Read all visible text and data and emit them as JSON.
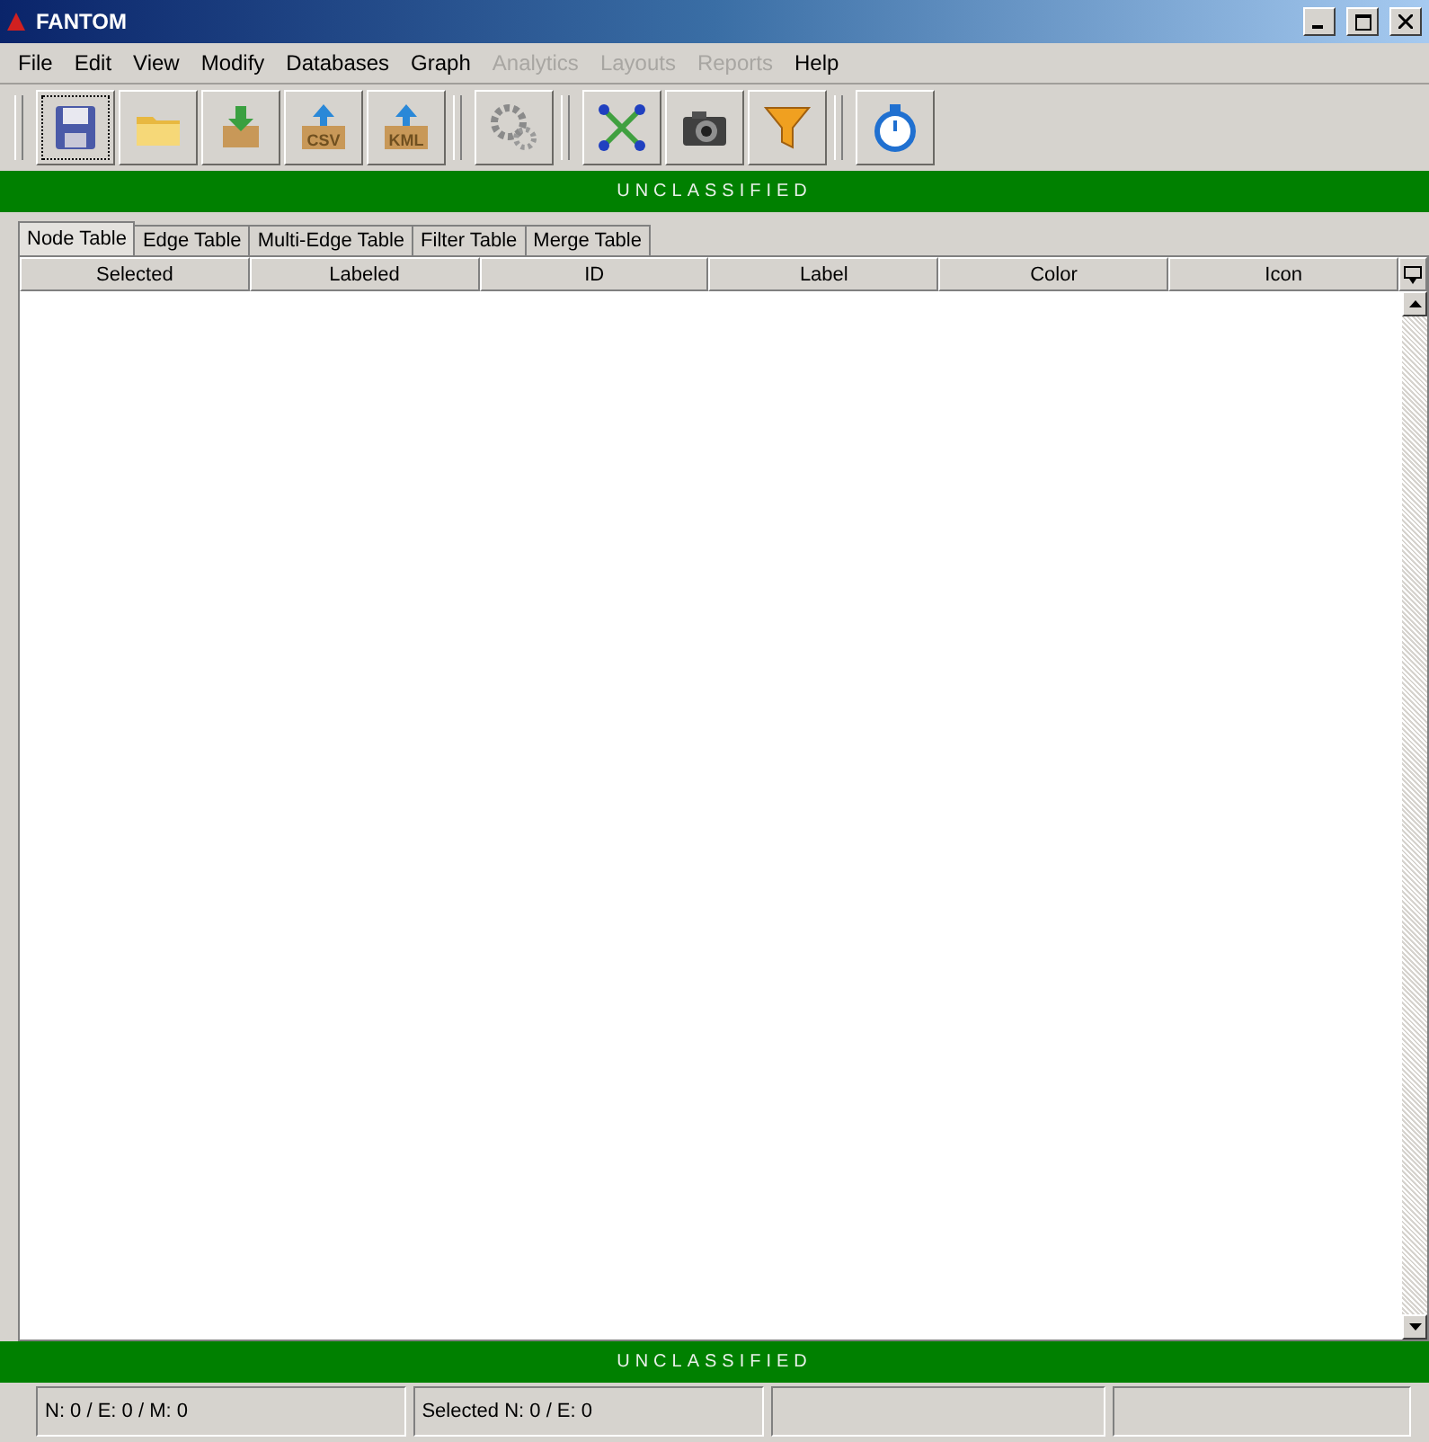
{
  "window": {
    "title": "FANTOM"
  },
  "menu": [
    {
      "label": "File",
      "disabled": false
    },
    {
      "label": "Edit",
      "disabled": false
    },
    {
      "label": "View",
      "disabled": false
    },
    {
      "label": "Modify",
      "disabled": false
    },
    {
      "label": "Databases",
      "disabled": false
    },
    {
      "label": "Graph",
      "disabled": false
    },
    {
      "label": "Analytics",
      "disabled": true
    },
    {
      "label": "Layouts",
      "disabled": true
    },
    {
      "label": "Reports",
      "disabled": true
    },
    {
      "label": "Help",
      "disabled": false
    }
  ],
  "toolbar": [
    [
      {
        "kind": "save",
        "focused": true
      },
      {
        "kind": "open",
        "focused": false
      },
      {
        "kind": "import",
        "focused": false
      },
      {
        "kind": "csv",
        "text": "CSV",
        "focused": false
      },
      {
        "kind": "kml",
        "text": "KML",
        "focused": false
      }
    ],
    [
      {
        "kind": "settings",
        "focused": false
      }
    ],
    [
      {
        "kind": "graph",
        "focused": false
      },
      {
        "kind": "camera",
        "focused": false
      },
      {
        "kind": "filter",
        "focused": false
      }
    ],
    [
      {
        "kind": "timer",
        "focused": false
      }
    ]
  ],
  "banner_top": "UNCLASSIFIED",
  "tabs": [
    {
      "label": "Node Table",
      "selected": true
    },
    {
      "label": "Edge Table",
      "selected": false
    },
    {
      "label": "Multi-Edge Table",
      "selected": false
    },
    {
      "label": "Filter Table",
      "selected": false
    },
    {
      "label": "Merge Table",
      "selected": false
    }
  ],
  "table": {
    "columns": [
      "Selected",
      "Labeled",
      "ID",
      "Label",
      "Color",
      "Icon"
    ]
  },
  "banner_bottom": "UNCLASSIFIED",
  "status_bar": [
    "N: 0 / E: 0 / M: 0",
    "Selected N: 0 / E: 0"
  ]
}
